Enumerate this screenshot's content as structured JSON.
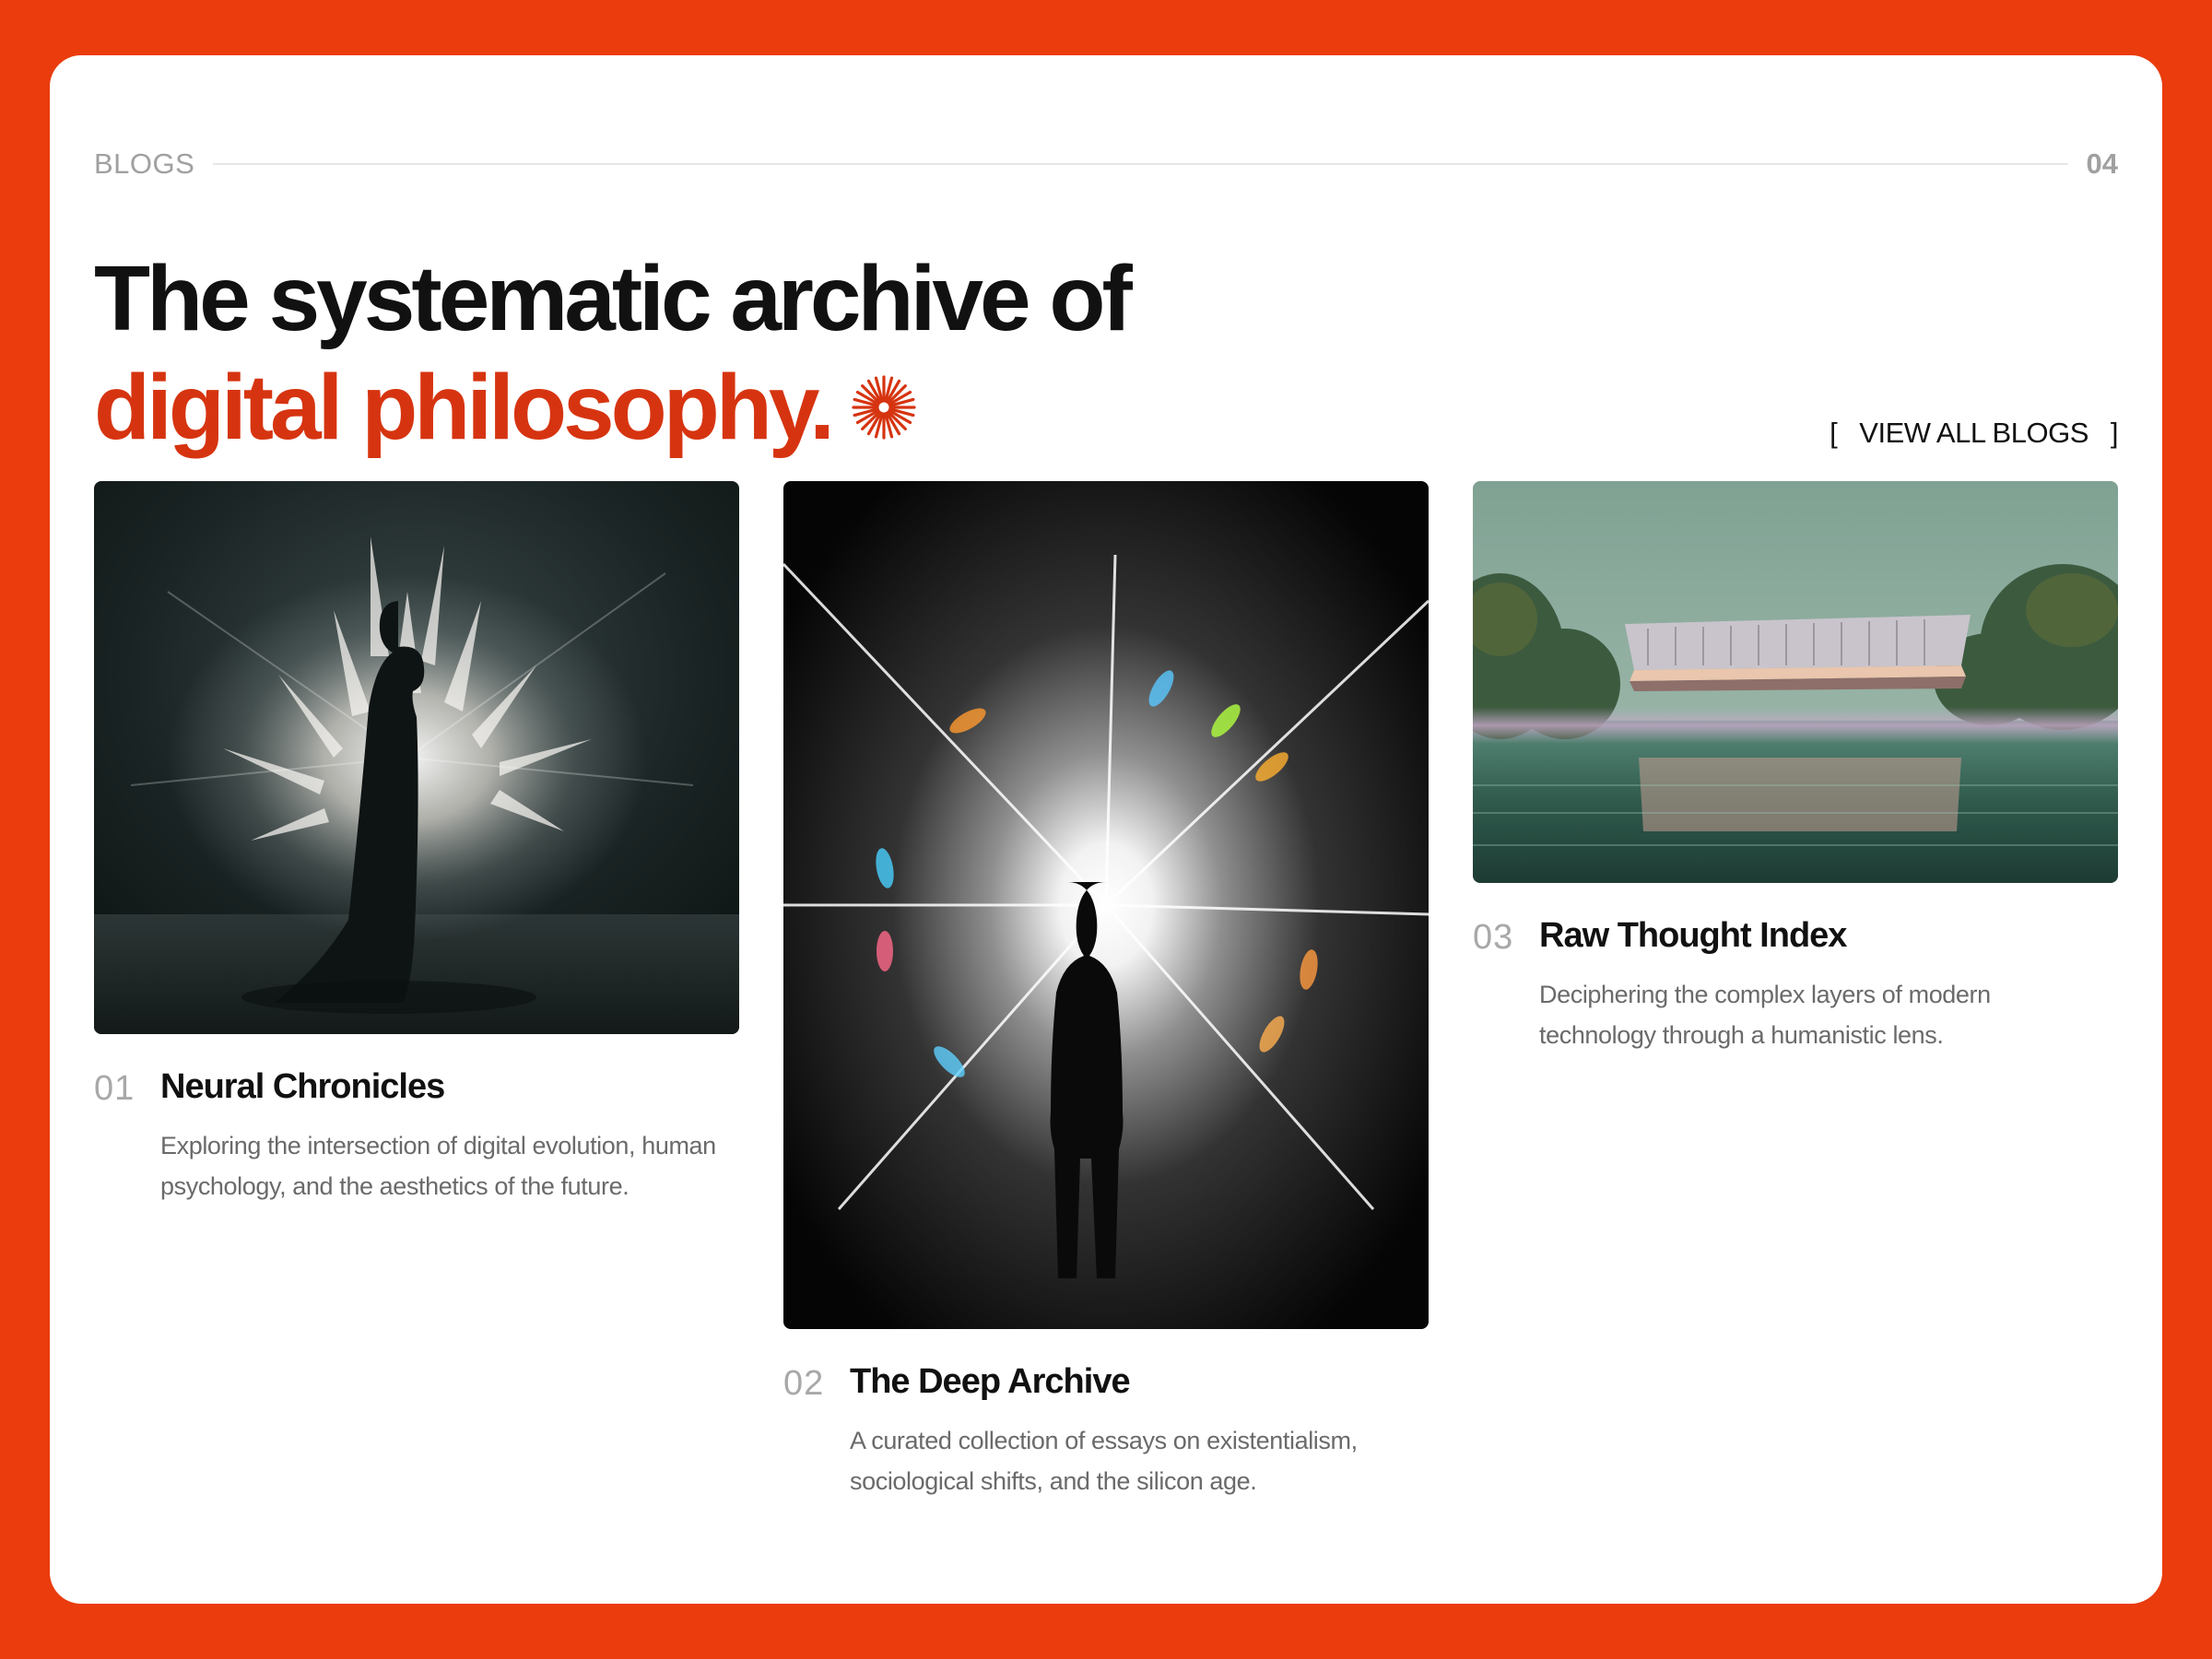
{
  "header": {
    "section_label": "BLOGS",
    "page_number": "04"
  },
  "headline": {
    "line1": "The systematic archive of",
    "line2": "digital philosophy."
  },
  "actions": {
    "view_all_open": "[",
    "view_all_label": "VIEW ALL BLOGS",
    "view_all_close": "]"
  },
  "posts": [
    {
      "number": "01",
      "title": "Neural Chronicles",
      "description": "Exploring the intersection of digital evolution, human psychology, and the aesthetics of the future."
    },
    {
      "number": "02",
      "title": "The Deep Archive",
      "description": "A curated collection of essays on existentialism, sociological shifts, and the silicon age."
    },
    {
      "number": "03",
      "title": "Raw Thought Index",
      "description": "Deciphering the complex layers of modern technology through a humanistic lens."
    }
  ],
  "colors": {
    "frame": "#ea3c0d",
    "accent": "#d63410",
    "text": "#111111",
    "muted": "#a0a0a0"
  },
  "icons": {
    "headline_mark": "starburst-icon"
  }
}
